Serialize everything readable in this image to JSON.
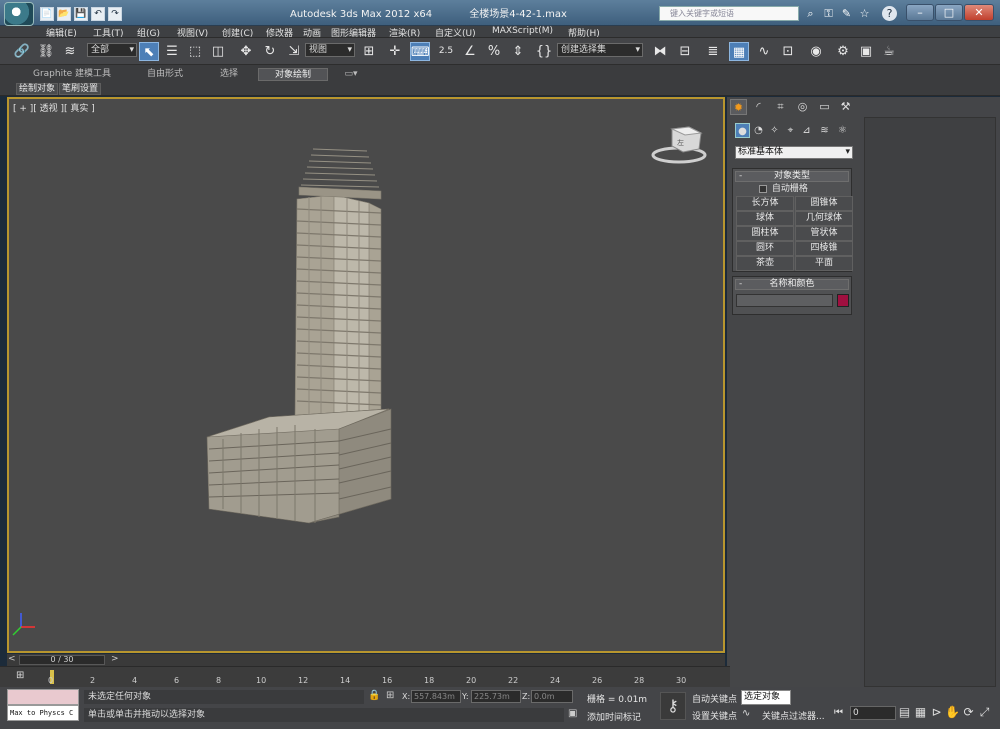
{
  "window": {
    "title": "Autodesk 3ds Max  2012 x64",
    "file": "全楼场景4-42-1.max",
    "search_placeholder": "键入关键字或短语",
    "minimize": "–",
    "maximize": "□",
    "close": "✕"
  },
  "quick_access": [
    "📄",
    "📂",
    "💾",
    "↶",
    "↷"
  ],
  "menu": [
    "编辑(E)",
    "工具(T)",
    "组(G)",
    "视图(V)",
    "创建(C)",
    "修改器",
    "动画",
    "图形编辑器",
    "渲染(R)",
    "自定义(U)",
    "MAXScript(M)",
    "帮助(H)"
  ],
  "toolbar": {
    "selection_filter": "全部",
    "ref_coord": "视图",
    "named_selection": "创建选择集",
    "snap_angle": "2.5"
  },
  "ribbon": {
    "tabs": [
      "Graphite 建模工具",
      "自由形式",
      "选择",
      "对象绘制"
    ],
    "active_tab": "对象绘制",
    "sub_buttons": [
      "绘制对象",
      "笔刷设置"
    ]
  },
  "viewport": {
    "label": "[ + ][ 透视 ][ 真实 ]",
    "viewcube_face": "左"
  },
  "command_panel": {
    "primitive_type": "标准基本体",
    "object_type_title": "对象类型",
    "autogrid_label": "自动栅格",
    "objects": [
      "长方体",
      "圆锥体",
      "球体",
      "几何球体",
      "圆柱体",
      "管状体",
      "圆环",
      "四棱锥",
      "茶壶",
      "平面"
    ],
    "name_color_title": "名称和颜色",
    "name_value": "",
    "object_color": "#a01040"
  },
  "time_slider": {
    "frame_display": "0 / 30",
    "ticks": [
      "0",
      "2",
      "4",
      "6",
      "8",
      "10",
      "12",
      "14",
      "16",
      "18",
      "20",
      "22",
      "24",
      "26",
      "28",
      "30"
    ]
  },
  "status": {
    "physx_label": "Max to Physcs C",
    "selection_msg": "未选定任何对象",
    "prompt_msg": "单击或单击并拖动以选择对象",
    "x_value": "557.843m",
    "y_value": "225.73m",
    "z_value": "0.0m",
    "grid_label": "栅格 = 0.01m",
    "add_time_tag": "添加时间标记",
    "auto_key": "自动关键点",
    "selected_dropdown": "选定对象",
    "set_key": "设置关键点",
    "key_filters": "关键点过滤器...",
    "current_frame": "0"
  }
}
